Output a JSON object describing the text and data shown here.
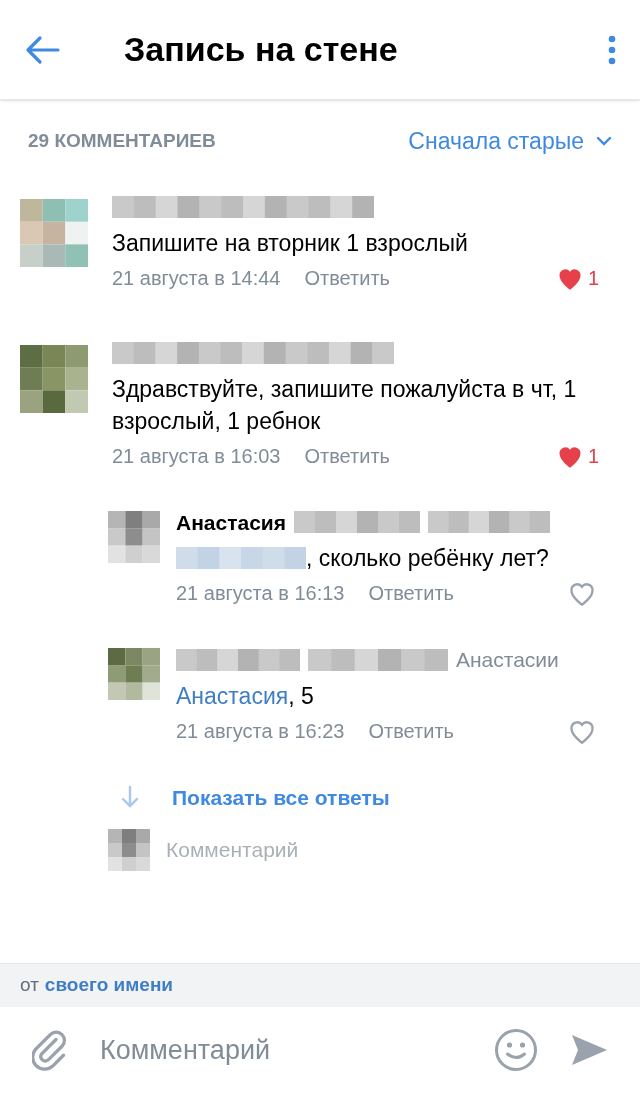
{
  "header": {
    "title": "Запись на стене"
  },
  "comments_bar": {
    "count": "29 КОММЕНТАРИЕВ",
    "sort": "Сначала старые"
  },
  "comments": [
    {
      "parts": [
        {
          "kind": "text",
          "text": "Запишите на вторник 1 взрослый"
        }
      ],
      "time": "21 августа в 14:44",
      "reply": "Ответить",
      "liked": true,
      "likes": "1"
    },
    {
      "parts": [
        {
          "kind": "text",
          "text": "Здравствуйте,  запишите пожалуйста в чт,  1 взрослый,  1 ребнок"
        }
      ],
      "time": "21 августа в 16:03",
      "reply": "Ответить",
      "liked": true,
      "likes": "1",
      "replies": [
        {
          "author": "Анастасия",
          "parts": [
            {
              "kind": "redacted"
            },
            {
              "kind": "text",
              "text": ", сколько ребёнку лет?"
            }
          ],
          "time": "21 августа в 16:13",
          "reply": "Ответить",
          "liked": false
        },
        {
          "reply_to": "Анастасии",
          "parts": [
            {
              "kind": "mention",
              "text": "Анастасия"
            },
            {
              "kind": "text",
              "text": ", 5"
            }
          ],
          "time": "21 августа в 16:23",
          "reply": "Ответить",
          "liked": false
        }
      ]
    }
  ],
  "show_all": "Показать все ответы",
  "reply_field": {
    "placeholder": "Комментарий"
  },
  "author_bar": {
    "prefix": "от",
    "name": "своего имени"
  },
  "composer": {
    "placeholder": "Комментарий"
  }
}
